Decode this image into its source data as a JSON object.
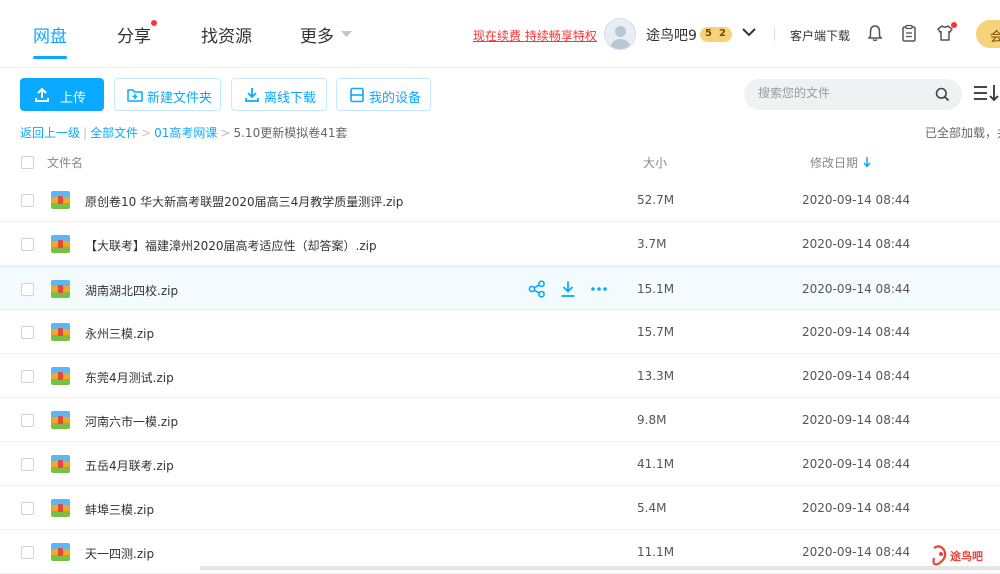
{
  "nav": {
    "items": [
      {
        "label": "网盘",
        "active": true
      },
      {
        "label": "分享",
        "badge": true
      },
      {
        "label": "找资源"
      },
      {
        "label": "更多"
      }
    ],
    "promo": "现在续费 持续畅享特权",
    "username": "途鸟吧9",
    "vip_level": "5",
    "vip_sub": "2",
    "client_download": "客户端下载",
    "member_label": "会"
  },
  "toolbar": {
    "upload": "上传",
    "new_folder": "新建文件夹",
    "offline_download": "离线下载",
    "my_devices": "我的设备",
    "search_placeholder": "搜索您的文件"
  },
  "breadcrumb": {
    "back": "返回上一级",
    "all_files": "全部文件",
    "folder1": "01高考网课",
    "current": "5.10更新模拟卷41套",
    "loaded_status": "已全部加载，共"
  },
  "table": {
    "col_name": "文件名",
    "col_size": "大小",
    "col_date": "修改日期",
    "rows": [
      {
        "name": "原创卷10 华大新高考联盟2020届高三4月教学质量测评.zip",
        "size": "52.7M",
        "date": "2020-09-14 08:44"
      },
      {
        "name": "【大联考】福建漳州2020届高考适应性（却答案）.zip",
        "size": "3.7M",
        "date": "2020-09-14 08:44"
      },
      {
        "name": "湖南湖北四校.zip",
        "size": "15.1M",
        "date": "2020-09-14 08:44"
      },
      {
        "name": "永州三模.zip",
        "size": "15.7M",
        "date": "2020-09-14 08:44"
      },
      {
        "name": "东莞4月测试.zip",
        "size": "13.3M",
        "date": "2020-09-14 08:44"
      },
      {
        "name": "河南六市一模.zip",
        "size": "9.8M",
        "date": "2020-09-14 08:44"
      },
      {
        "name": "五岳4月联考.zip",
        "size": "41.1M",
        "date": "2020-09-14 08:44"
      },
      {
        "name": "蚌埠三模.zip",
        "size": "5.4M",
        "date": "2020-09-14 08:44"
      },
      {
        "name": "天一四测.zip",
        "size": "11.1M",
        "date": "2020-09-14 08:44"
      }
    ]
  },
  "colors": {
    "accent": "#09aaff",
    "promo": "#ff3333",
    "vip": "#f6d27a"
  },
  "watermark": "途鸟吧"
}
